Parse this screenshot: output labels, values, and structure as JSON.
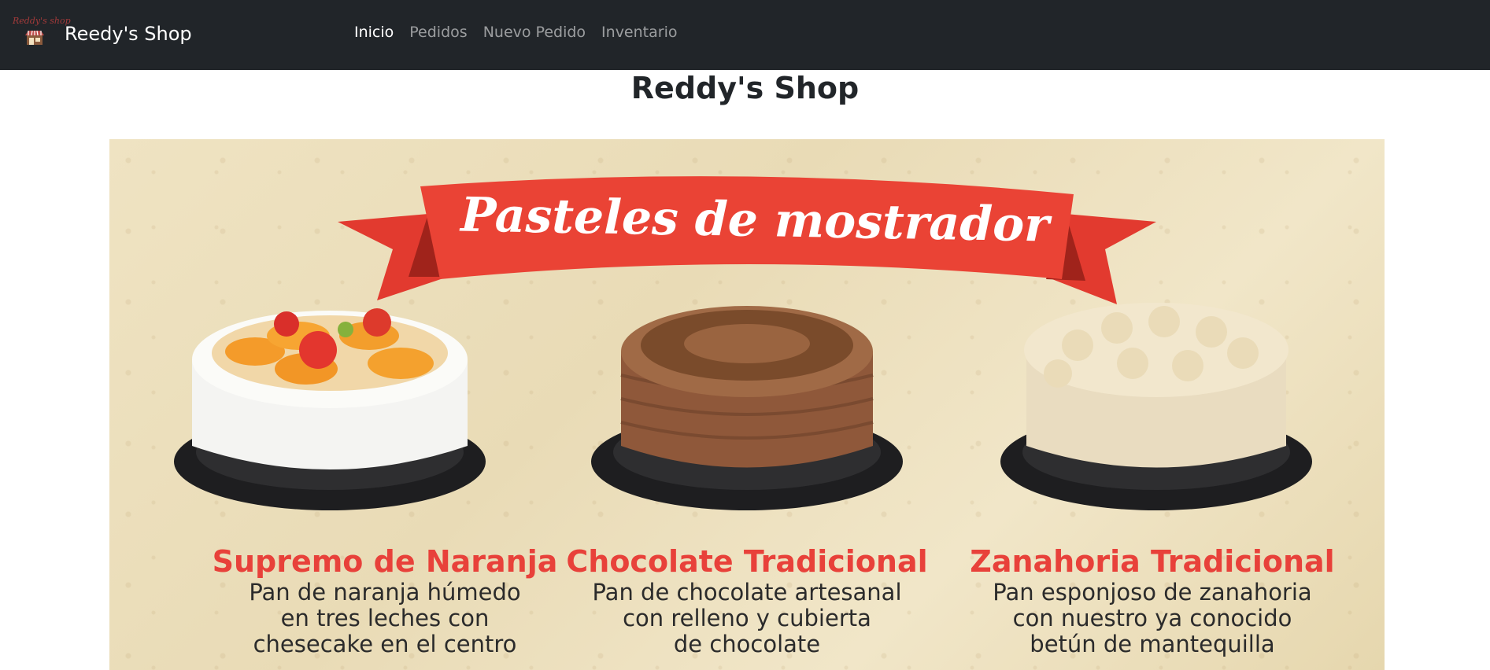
{
  "navbar": {
    "logo_text": "Reddy's shop",
    "brand": "Reedy's Shop",
    "links": [
      {
        "label": "Inicio",
        "active": true
      },
      {
        "label": "Pedidos",
        "active": false
      },
      {
        "label": "Nuevo Pedido",
        "active": false
      },
      {
        "label": "Inventario",
        "active": false
      }
    ],
    "background": "#212529"
  },
  "main": {
    "title": "Reddy's Shop"
  },
  "banner": {
    "heading": "Pasteles de mostrador",
    "accent_color": "#e8413a",
    "cakes": [
      {
        "name": "Supremo de Naranja",
        "description": "Pan de naranja húmedo\nen tres leches con\nchesecake en el centro"
      },
      {
        "name": "Chocolate Tradicional",
        "description": "Pan de chocolate artesanal\ncon relleno y cubierta\nde chocolate"
      },
      {
        "name": "Zanahoria Tradicional",
        "description": "Pan esponjoso de zanahoria\ncon nuestro  ya conocido\nbetún de mantequilla"
      }
    ]
  }
}
